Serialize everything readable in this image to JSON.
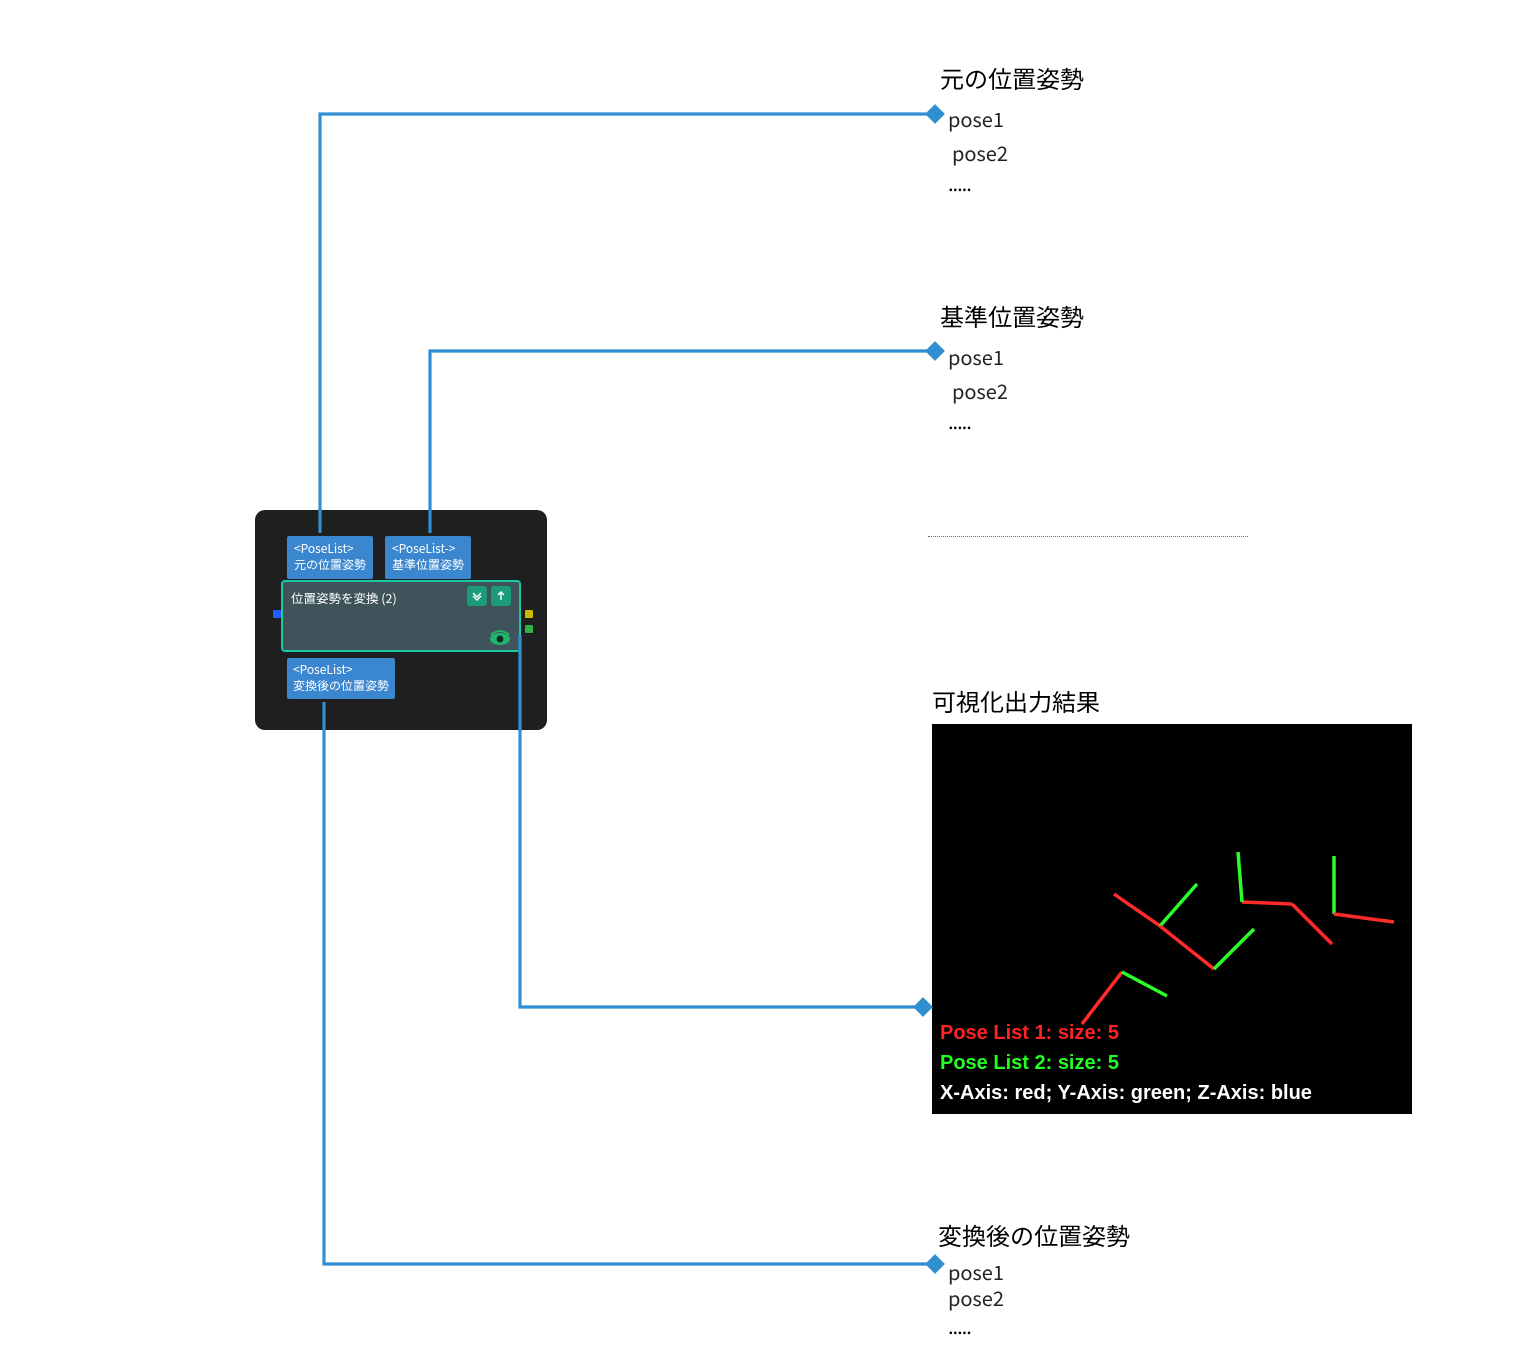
{
  "sections": {
    "original": {
      "title": "元の位置姿勢",
      "items": [
        "pose1",
        "pose2",
        "....."
      ]
    },
    "reference": {
      "title": "基準位置姿勢",
      "items": [
        "pose1",
        "pose2",
        "....."
      ]
    },
    "viz": {
      "title": "可視化出力結果",
      "list1": "Pose List 1: size: 5",
      "list2": "Pose List 2: size: 5",
      "axes": "X-Axis: red; Y-Axis: green; Z-Axis: blue"
    },
    "converted": {
      "title": "変換後の位置姿勢",
      "items": [
        "pose1",
        "pose2",
        "....."
      ]
    }
  },
  "node": {
    "port_in1_type": "<PoseList>",
    "port_in1_label": "元の位置姿勢",
    "port_in2_type": "<PoseList->",
    "port_in2_label": "基準位置姿勢",
    "title": "位置姿勢を変換 (2)",
    "port_out_type": "<PoseList>",
    "port_out_label": "変換後の位置姿勢"
  },
  "colors": {
    "connector": "#2f8fd0",
    "viz_list1": "#ff2222",
    "viz_list2": "#22ff22",
    "viz_axes": "#ffffff",
    "axis_red": "#ff2a2a",
    "axis_green": "#2aff2a"
  }
}
